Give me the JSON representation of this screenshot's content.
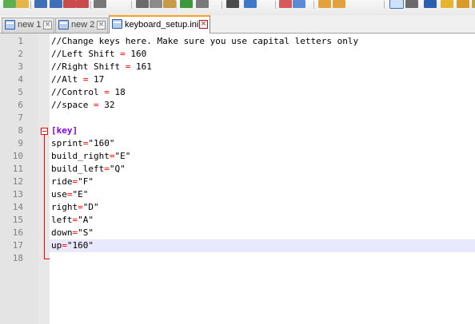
{
  "toolbar": {
    "icons": [
      {
        "name": "new-file-icon",
        "color": "#5cae4f"
      },
      {
        "name": "open-file-icon",
        "color": "#e7b64a"
      },
      {
        "name": "save-icon",
        "color": "#3f6fb6"
      },
      {
        "name": "save-all-icon",
        "color": "#3f6fb6"
      },
      {
        "name": "close-icon",
        "color": "#c94b4b"
      },
      {
        "name": "close-all-icon",
        "color": "#c94b4b"
      },
      {
        "name": "print-icon",
        "color": "#777777"
      },
      {
        "name": "cut-icon",
        "color": "#6b6b6b"
      },
      {
        "name": "copy-icon",
        "color": "#8a8a8a"
      },
      {
        "name": "paste-icon",
        "color": "#c99a45"
      },
      {
        "name": "undo-icon",
        "color": "#3c9a3c"
      },
      {
        "name": "redo-icon",
        "color": "#7a7a7a"
      },
      {
        "name": "find-icon",
        "color": "#4a4a4a"
      },
      {
        "name": "replace-icon",
        "color": "#3d78c9"
      },
      {
        "name": "zoom-in-icon",
        "color": "#d65a5a"
      },
      {
        "name": "zoom-out-icon",
        "color": "#5a8ad6"
      },
      {
        "name": "sync-vertical-icon",
        "color": "#e2a33c"
      },
      {
        "name": "sync-horizontal-icon",
        "color": "#e2a33c"
      },
      {
        "name": "word-wrap-icon",
        "color": "#3a6ec0"
      },
      {
        "name": "show-all-chars-icon",
        "color": "#6b6b6b"
      },
      {
        "name": "indent-guide-icon",
        "color": "#2d5fb0"
      },
      {
        "name": "user-language-icon",
        "color": "#e6b42e"
      },
      {
        "name": "doc-map-icon",
        "color": "#d99c2a"
      },
      {
        "name": "function-list-icon",
        "color": "#c4a24a"
      }
    ]
  },
  "tabs": [
    {
      "label": "new 1",
      "active": false
    },
    {
      "label": "new 2",
      "active": false
    },
    {
      "label": "keyboard_setup.ini",
      "active": true
    }
  ],
  "editor": {
    "lines": [
      {
        "number": "1",
        "parts": [
          {
            "t": "//Change keys here. Make sure you use capital letters only",
            "c": "c-comment"
          }
        ]
      },
      {
        "number": "2",
        "parts": [
          {
            "t": "//Left Shift ",
            "c": "c-comment"
          },
          {
            "t": "=",
            "c": "c-op"
          },
          {
            "t": " 160",
            "c": "c-val"
          }
        ]
      },
      {
        "number": "3",
        "parts": [
          {
            "t": "//Right Shift ",
            "c": "c-comment"
          },
          {
            "t": "=",
            "c": "c-op"
          },
          {
            "t": " 161",
            "c": "c-val"
          }
        ]
      },
      {
        "number": "4",
        "parts": [
          {
            "t": "//Alt ",
            "c": "c-comment"
          },
          {
            "t": "=",
            "c": "c-op"
          },
          {
            "t": " 17",
            "c": "c-val"
          }
        ]
      },
      {
        "number": "5",
        "parts": [
          {
            "t": "//Control ",
            "c": "c-comment"
          },
          {
            "t": "=",
            "c": "c-op"
          },
          {
            "t": " 18",
            "c": "c-val"
          }
        ]
      },
      {
        "number": "6",
        "parts": [
          {
            "t": "//space ",
            "c": "c-comment"
          },
          {
            "t": "=",
            "c": "c-op"
          },
          {
            "t": " 32",
            "c": "c-val"
          }
        ]
      },
      {
        "number": "7",
        "parts": []
      },
      {
        "number": "8",
        "parts": [
          {
            "t": "[key]",
            "c": "c-section"
          }
        ]
      },
      {
        "number": "9",
        "parts": [
          {
            "t": "sprint",
            "c": "c-key"
          },
          {
            "t": "=",
            "c": "c-op"
          },
          {
            "t": "\"160\"",
            "c": "c-val"
          }
        ]
      },
      {
        "number": "10",
        "parts": [
          {
            "t": "build_right",
            "c": "c-key"
          },
          {
            "t": "=",
            "c": "c-op"
          },
          {
            "t": "\"E\"",
            "c": "c-val"
          }
        ]
      },
      {
        "number": "11",
        "parts": [
          {
            "t": "build_left",
            "c": "c-key"
          },
          {
            "t": "=",
            "c": "c-op"
          },
          {
            "t": "\"Q\"",
            "c": "c-val"
          }
        ]
      },
      {
        "number": "12",
        "parts": [
          {
            "t": "ride",
            "c": "c-key"
          },
          {
            "t": "=",
            "c": "c-op"
          },
          {
            "t": "\"F\"",
            "c": "c-val"
          }
        ]
      },
      {
        "number": "13",
        "parts": [
          {
            "t": "use",
            "c": "c-key"
          },
          {
            "t": "=",
            "c": "c-op"
          },
          {
            "t": "\"E\"",
            "c": "c-val"
          }
        ]
      },
      {
        "number": "14",
        "parts": [
          {
            "t": "right",
            "c": "c-key"
          },
          {
            "t": "=",
            "c": "c-op"
          },
          {
            "t": "\"D\"",
            "c": "c-val"
          }
        ]
      },
      {
        "number": "15",
        "parts": [
          {
            "t": "left",
            "c": "c-key"
          },
          {
            "t": "=",
            "c": "c-op"
          },
          {
            "t": "\"A\"",
            "c": "c-val"
          }
        ]
      },
      {
        "number": "16",
        "parts": [
          {
            "t": "down",
            "c": "c-key"
          },
          {
            "t": "=",
            "c": "c-op"
          },
          {
            "t": "\"S\"",
            "c": "c-val"
          }
        ]
      },
      {
        "number": "17",
        "parts": [
          {
            "t": "up",
            "c": "c-key"
          },
          {
            "t": "=",
            "c": "c-op"
          },
          {
            "t": "\"160\"",
            "c": "c-val"
          }
        ]
      },
      {
        "number": "18",
        "parts": []
      }
    ]
  },
  "colors": {
    "active_tab_accent": "#f8a31f",
    "section_header": "#8000ff",
    "operator": "#ff0000",
    "fold_marker": "#ff0000",
    "current_line_highlight": "#e8e8ff"
  }
}
